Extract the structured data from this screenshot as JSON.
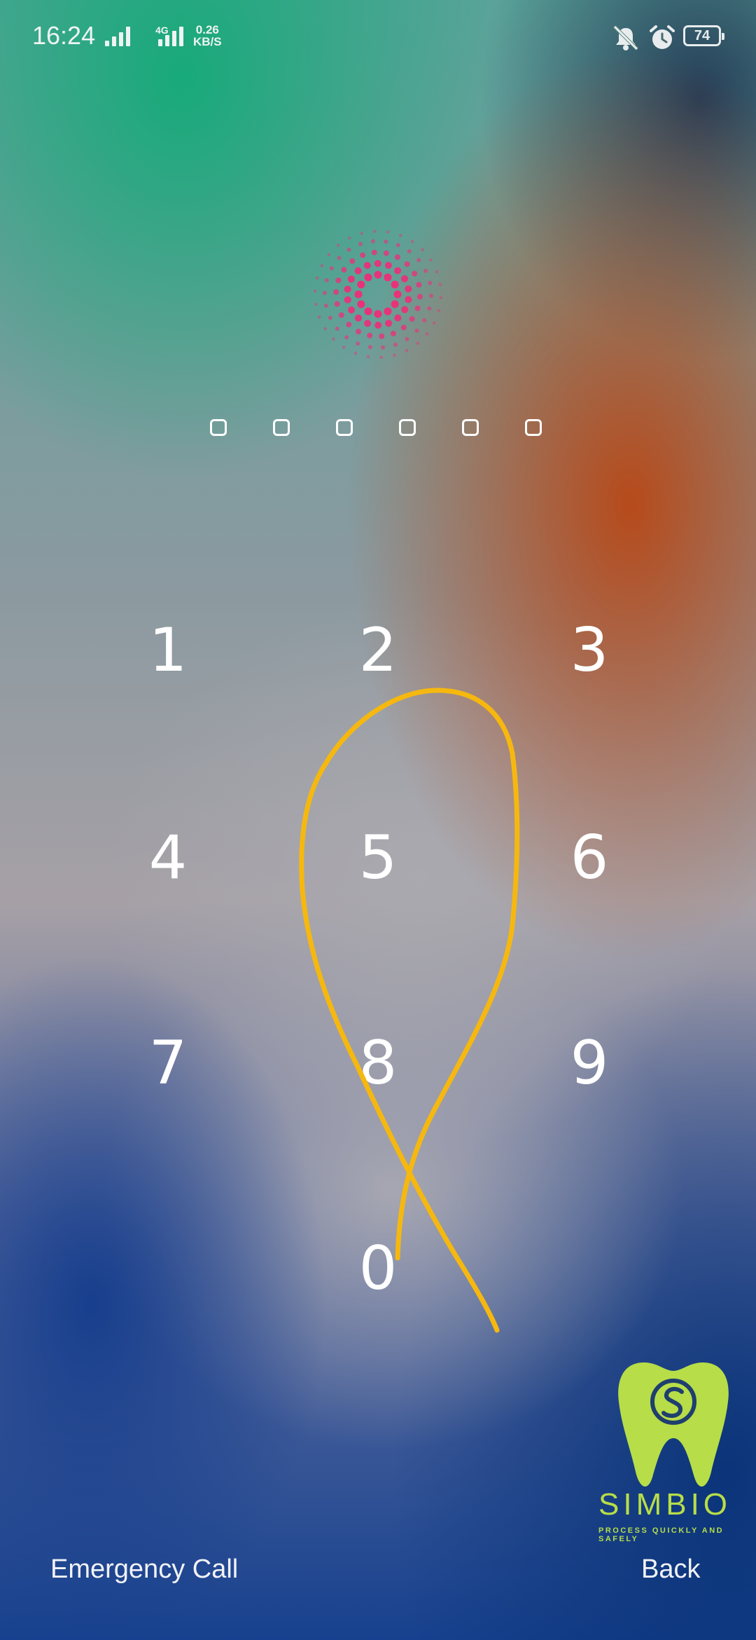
{
  "status_bar": {
    "time": "16:24",
    "network_type": "4G",
    "speed_value": "0.26",
    "speed_unit": "KB/S",
    "battery_level": "74",
    "icons": [
      "signal-icon",
      "signal-4g-icon",
      "mute-vibrate-icon",
      "alarm-icon",
      "battery-icon"
    ]
  },
  "lock_logo": {
    "icon": "dotted-ring-logo-icon",
    "color": "#e8327a"
  },
  "pin": {
    "slots": 6,
    "filled": 0
  },
  "keypad": {
    "keys": [
      "1",
      "2",
      "3",
      "4",
      "5",
      "6",
      "7",
      "8",
      "9",
      "0"
    ]
  },
  "doodle": {
    "color": "#f6b80f"
  },
  "watermark": {
    "brand": "SIMBIO",
    "tagline": "PROCESS QUICKLY AND SAFELY",
    "color": "#b7dd48"
  },
  "actions": {
    "emergency_label": "Emergency Call",
    "back_label": "Back"
  }
}
